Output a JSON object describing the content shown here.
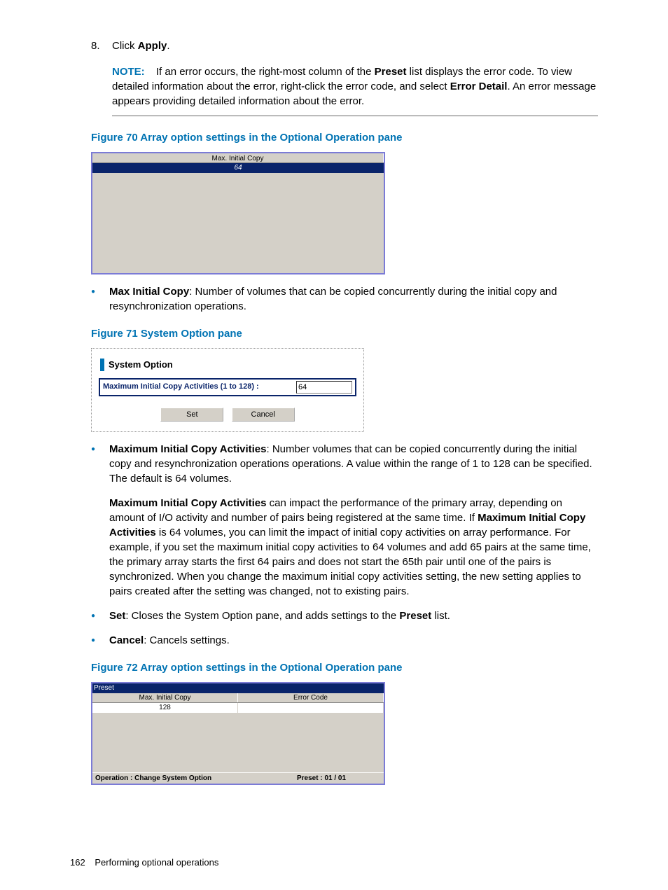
{
  "step8": {
    "num": "8.",
    "pre": "Click ",
    "bold": "Apply",
    "post": "."
  },
  "note": {
    "label": "NOTE:",
    "t1": "If an error occurs, the right-most column of the ",
    "b1": "Preset",
    "t2": " list displays the error code. To view detailed information about the error, right-click the error code, and select ",
    "b2": "Error Detail",
    "t3": ". An error message appears providing detailed information about the error."
  },
  "fig70": {
    "caption": "Figure 70 Array option settings in the Optional Operation pane",
    "header": "Max. Initial Copy",
    "value": "64"
  },
  "bullet_maxinit": {
    "b1": "Max Initial Copy",
    "t1": ": Number of volumes that can be copied concurrently during the initial copy and resynchronization operations."
  },
  "fig71": {
    "caption": "Figure 71 System Option pane",
    "title": "System Option",
    "label": "Maximum Initial Copy Activities (1 to 128) :",
    "value": "64",
    "set": "Set",
    "cancel": "Cancel"
  },
  "bullet_mica": {
    "b1": "Maximum Initial Copy Activities",
    "t1": ": Number volumes that can be copied concurrently during the initial copy and resynchronization operations operations. A value within the range of 1 to 128 can be specified. The default is 64 volumes."
  },
  "para_mica": {
    "b1": "Maximum Initial Copy Activities",
    "t1": " can impact the performance of the primary array, depending on amount of I/O activity and number of pairs being registered at the same time. If ",
    "b2": "Maximum Initial Copy Activities",
    "t2": " is 64 volumes, you can limit the impact of initial copy activities on array performance. For example, if you set the maximum initial copy activities to 64 volumes and add 65 pairs at the same time, the primary array starts the first 64 pairs and does not start the 65th pair until one of the pairs is synchronized. When you change the maximum initial copy activities setting, the new setting applies to pairs created after the setting was changed, not to existing pairs."
  },
  "bullet_set": {
    "b1": "Set",
    "t1": ": Closes the System Option pane, and adds settings to the ",
    "b2": "Preset",
    "t2": " list."
  },
  "bullet_cancel": {
    "b1": "Cancel",
    "t1": ": Cancels settings."
  },
  "fig72": {
    "caption": "Figure 72 Array option settings in the Optional Operation pane",
    "title": "Preset",
    "h1": "Max. Initial Copy",
    "h2": "Error Code",
    "v1": "128",
    "v2": "",
    "status1": "Operation : Change System Option",
    "status2": "Preset : 01 / 01"
  },
  "footer": {
    "page": "162",
    "title": "Performing optional operations"
  }
}
